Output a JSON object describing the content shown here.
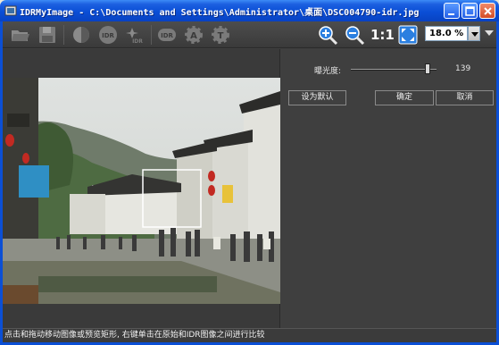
{
  "window": {
    "title": "IDRMyImage - C:\\Documents and Settings\\Administrator\\桌面\\DSC004790-idr.jpg"
  },
  "toolbar": {
    "tools": [
      {
        "name": "open-folder-icon"
      },
      {
        "name": "save-disk-icon"
      },
      {
        "name": "contrast-icon"
      },
      {
        "name": "idr-icon"
      },
      {
        "name": "idr-sparkle-icon"
      },
      {
        "name": "idr-alt-icon"
      },
      {
        "name": "gear-a-icon"
      },
      {
        "name": "gear-t-icon"
      },
      {
        "name": "zoom-in-icon"
      },
      {
        "name": "zoom-out-icon"
      },
      {
        "name": "fit-to-window-icon"
      }
    ],
    "ratio_label": "1:1",
    "zoom_value": "18.0 %"
  },
  "panel": {
    "exposure_label": "曝光度:",
    "exposure_value": "139",
    "exposure_fraction": 0.9,
    "default_button": "设为默认",
    "ok_button": "确定",
    "cancel_button": "取消"
  },
  "status_text": "点击和拖动移动图像或预览矩形, 右键单击在原始和IDR图像之间进行比较",
  "colors": {
    "titlebar": "#0a4fd5",
    "background": "#3f3f3f",
    "text": "#f0f0f0"
  }
}
